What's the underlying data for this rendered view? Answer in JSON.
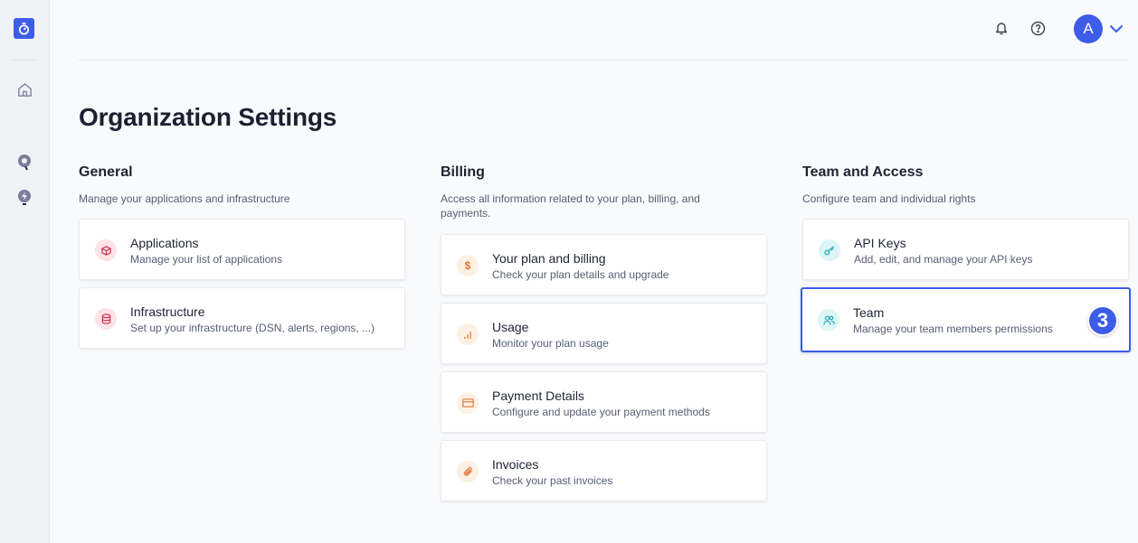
{
  "colors": {
    "accent": "#3d5ce8",
    "general_icon_bg": "#fde2e6",
    "general_icon_fg": "#d0314e",
    "billing_icon_bg": "#fef1e4",
    "billing_icon_fg": "#e07a3a",
    "team_icon_bg": "#ddf5f7",
    "team_icon_fg": "#1aa6b7"
  },
  "sidebar": {
    "logo_icon": "stopwatch-icon",
    "items": [
      {
        "icon": "home-icon"
      },
      {
        "icon": "search-bulb-icon"
      },
      {
        "icon": "lightning-bulb-icon"
      }
    ]
  },
  "header": {
    "notifications_icon": "bell-icon",
    "help_icon": "help-icon",
    "avatar_initial": "A",
    "menu_icon": "chevron-down-icon"
  },
  "page": {
    "title": "Organization Settings"
  },
  "sections": [
    {
      "title": "General",
      "description": "Manage your applications and infrastructure",
      "cards": [
        {
          "title": "Applications",
          "description": "Manage your list of applications",
          "icon": "cube-icon"
        },
        {
          "title": "Infrastructure",
          "description": "Set up your infrastructure (DSN, alerts, regions, ...)",
          "icon": "database-icon"
        }
      ]
    },
    {
      "title": "Billing",
      "description": "Access all information related to your plan, billing, and payments.",
      "cards": [
        {
          "title": "Your plan and billing",
          "description": "Check your plan details and upgrade",
          "icon": "dollar-icon"
        },
        {
          "title": "Usage",
          "description": "Monitor your plan usage",
          "icon": "signal-bars-icon"
        },
        {
          "title": "Payment Details",
          "description": "Configure and update your payment methods",
          "icon": "credit-card-icon"
        },
        {
          "title": "Invoices",
          "description": "Check your past invoices",
          "icon": "paperclip-icon"
        }
      ]
    },
    {
      "title": "Team and Access",
      "description": "Configure team and individual rights",
      "cards": [
        {
          "title": "API Keys",
          "description": "Add, edit, and manage your API keys",
          "icon": "key-icon"
        },
        {
          "title": "Team",
          "description": "Manage your team members permissions",
          "icon": "users-icon",
          "selected": true,
          "badge": "3"
        }
      ]
    }
  ]
}
